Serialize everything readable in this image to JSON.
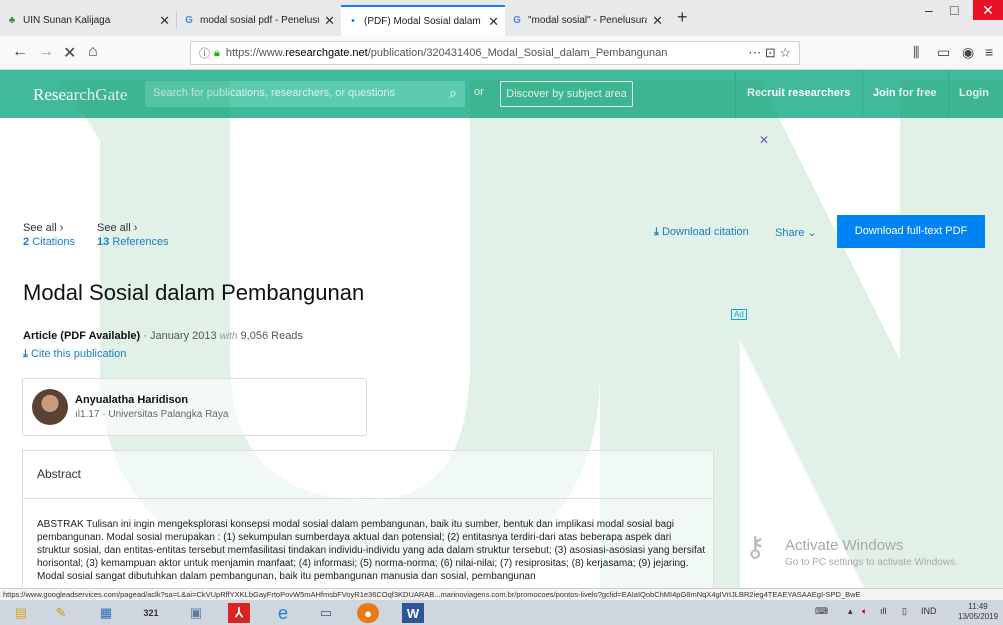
{
  "browser": {
    "tabs": [
      {
        "title": "UIN Sunan Kalijaga",
        "favicon": "uin-icon",
        "active": false
      },
      {
        "title": "modal sosial pdf - Penelusuran",
        "favicon": "google-icon",
        "active": false
      },
      {
        "title": "(PDF) Modal Sosial dalam Pem",
        "favicon": "rg-icon",
        "active": true
      },
      {
        "title": "\"modal sosial\" - Penelusuran G",
        "favicon": "google-icon",
        "active": false
      }
    ],
    "new_tab": "+",
    "window_min": "–",
    "window_max": "□",
    "window_close": "✕",
    "url_prefix": "https://www.",
    "url_host": "researchgate.net",
    "url_path": "/publication/320431406_Modal_Sosial_dalam_Pembangunan",
    "url_tools": "⋯ ⊡ ☆"
  },
  "site": {
    "logo": "ResearchGate",
    "search_placeholder": "Search for publications, researchers, or questions",
    "or": "or",
    "discover": "Discover by subject area",
    "recruit": "Recruit researchers",
    "join": "Join for free",
    "login": "Login"
  },
  "publication": {
    "citations_see": "See all ›",
    "citations_count": "2",
    "citations_label": "Citations",
    "refs_see": "See all ›",
    "refs_count": "13",
    "refs_label": "References",
    "download_citation": "Download citation",
    "share": "Share",
    "download_pdf": "Download full-text PDF",
    "title": "Modal Sosial dalam Pembangunan",
    "article_type": "Article (PDF Available)",
    "date": "January 2013",
    "with": "with",
    "reads": "9,056 Reads",
    "cite": "Cite this publication",
    "ad_tag": "Ad",
    "author_name": "Anyualatha Haridison",
    "author_score": "1.17",
    "author_affiliation": "Universitas Palangka Raya",
    "abstract_heading": "Abstract",
    "abstract_text": "ABSTRAK Tulisan ini ingin mengeksplorasi konsepsi modal sosial dalam pembangunan, baik itu sumber, bentuk dan implikasi modal sosial bagi pembangunan. Modal sosial merupakan : (1) sekumpulan sumberdaya aktual dan potensial; (2) entitasnya terdiri-dari atas beberapa aspek dari struktur sosial, dan entitas-entitas tersebut memfasilitasi tindakan individu-individu yang ada dalam struktur tersebut; (3) asosiasi-asosiasi yang bersifat horisontal; (3) kemampuan aktor untuk menjamin manfaat; (4) informasi; (5) norma-norma; (6) nilai-nilai; (7) resiprositas; (8) kerjasama; (9) jejaring. Modal sosial sangat dibutuhkan dalam pembangunan, baik itu pembangunan manusia dan sosial, pembangunan"
  },
  "os": {
    "activate_title": "Activate Windows",
    "activate_sub": "Go to PC settings to activate Windows.",
    "status_url": "https://www.googleadservices.com/pagead/aclk?sa=L&ai=CkVUpRffYXKLbGayFrtoPovW5mAHfmsbFVoyR1e36COqf3KDUARAB...marinoviagens.com.br/promocoes/pontos-livelo?gclid=EAIaIQobChMI4pG8mNqX4gIVrIJLBR2ieg4TEAEYASAAEgI-SPD_BwE",
    "lang": "IND",
    "time": "11:49",
    "date": "13/05/2019"
  }
}
